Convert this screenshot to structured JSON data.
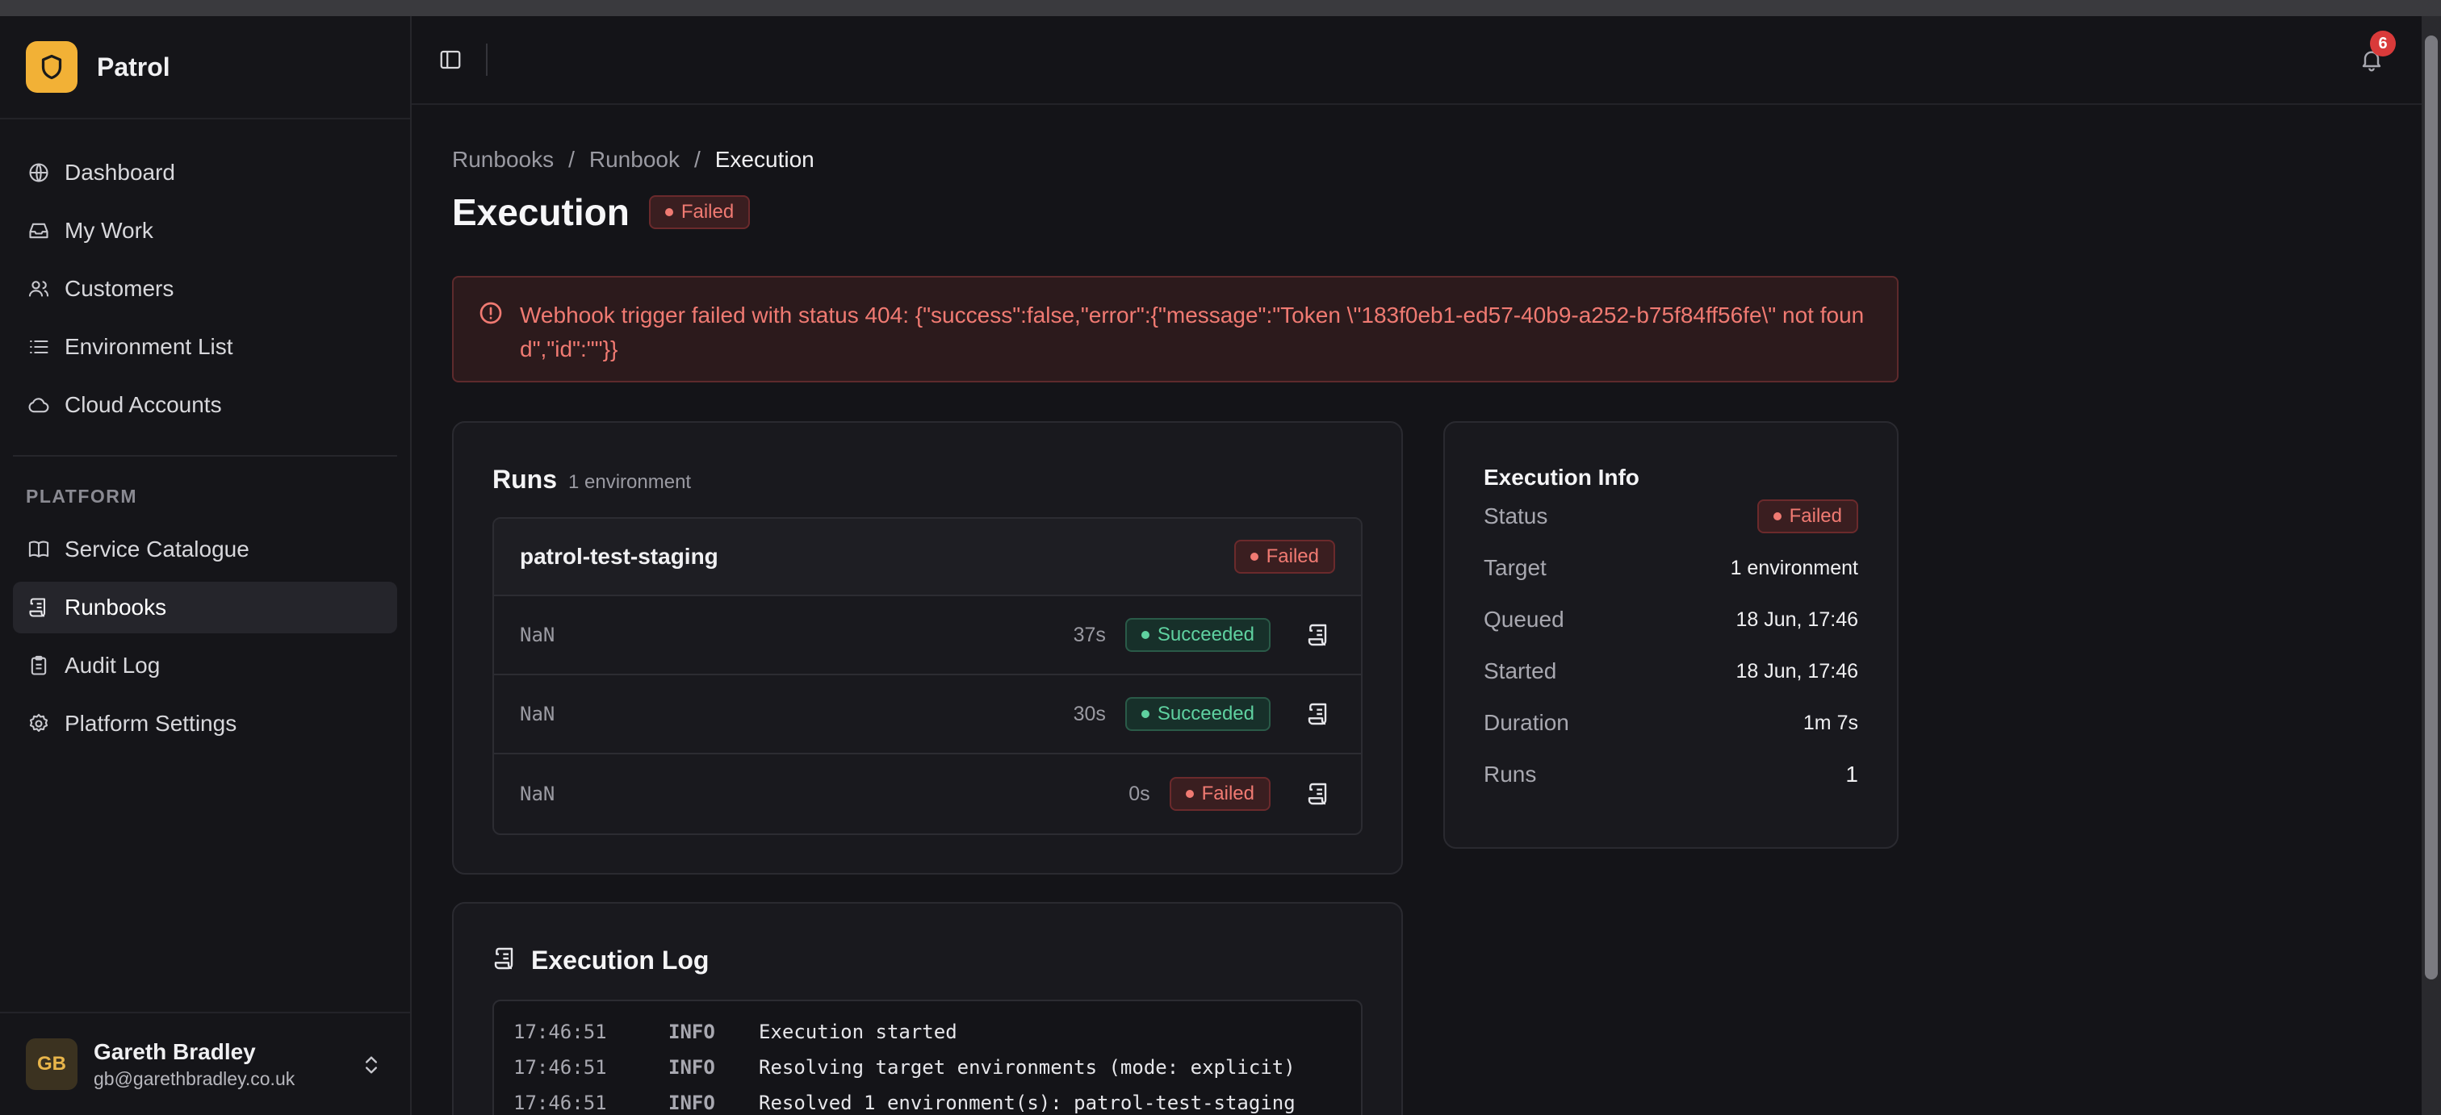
{
  "brand": {
    "name": "Patrol"
  },
  "sidebar": {
    "nav": [
      {
        "label": "Dashboard",
        "icon": "globe-icon"
      },
      {
        "label": "My Work",
        "icon": "inbox-icon"
      },
      {
        "label": "Customers",
        "icon": "users-icon"
      },
      {
        "label": "Environment List",
        "icon": "list-icon"
      },
      {
        "label": "Cloud Accounts",
        "icon": "cloud-icon"
      }
    ],
    "section_label": "PLATFORM",
    "platform": [
      {
        "label": "Service Catalogue",
        "icon": "book-icon"
      },
      {
        "label": "Runbooks",
        "icon": "scroll-icon",
        "active": true
      },
      {
        "label": "Audit Log",
        "icon": "clipboard-icon"
      },
      {
        "label": "Platform Settings",
        "icon": "gear-icon"
      }
    ]
  },
  "user": {
    "initials": "GB",
    "name": "Gareth Bradley",
    "email": "gb@garethbradley.co.uk"
  },
  "header": {
    "notification_count": "6"
  },
  "breadcrumb": {
    "items": [
      "Runbooks",
      "Runbook",
      "Execution"
    ],
    "separator": "/"
  },
  "page": {
    "title": "Execution",
    "status": "Failed"
  },
  "alert": {
    "message": "Webhook trigger failed with status 404: {\"success\":false,\"error\":{\"message\":\"Token \\\"183f0eb1-ed57-40b9-a252-b75f84ff56fe\\\" not found\",\"id\":\"\"}}"
  },
  "runs": {
    "title": "Runs",
    "subtitle": "1 environment",
    "environment": {
      "name": "patrol-test-staging",
      "status": "Failed"
    },
    "rows": [
      {
        "id": "NaN",
        "duration": "37s",
        "status": "Succeeded"
      },
      {
        "id": "NaN",
        "duration": "30s",
        "status": "Succeeded"
      },
      {
        "id": "NaN",
        "duration": "0s",
        "status": "Failed"
      }
    ]
  },
  "info": {
    "title": "Execution Info",
    "status_label": "Status",
    "status": "Failed",
    "target_label": "Target",
    "target": "1 environment",
    "queued_label": "Queued",
    "queued": "18 Jun, 17:46",
    "started_label": "Started",
    "started": "18 Jun, 17:46",
    "duration_label": "Duration",
    "duration": "1m 7s",
    "runs_label": "Runs",
    "runs": "1"
  },
  "log": {
    "title": "Execution Log",
    "lines": [
      {
        "time": "17:46:51",
        "level": "INFO",
        "message": "Execution started"
      },
      {
        "time": "17:46:51",
        "level": "INFO",
        "message": "Resolving target environments (mode: explicit)"
      },
      {
        "time": "17:46:51",
        "level": "INFO",
        "message": "Resolved 1 environment(s): patrol-test-staging"
      }
    ]
  },
  "colors": {
    "accent": "#f2b136",
    "failed": "#f07a72",
    "succeeded": "#5fd1a0",
    "badge": "#d93a3a"
  }
}
